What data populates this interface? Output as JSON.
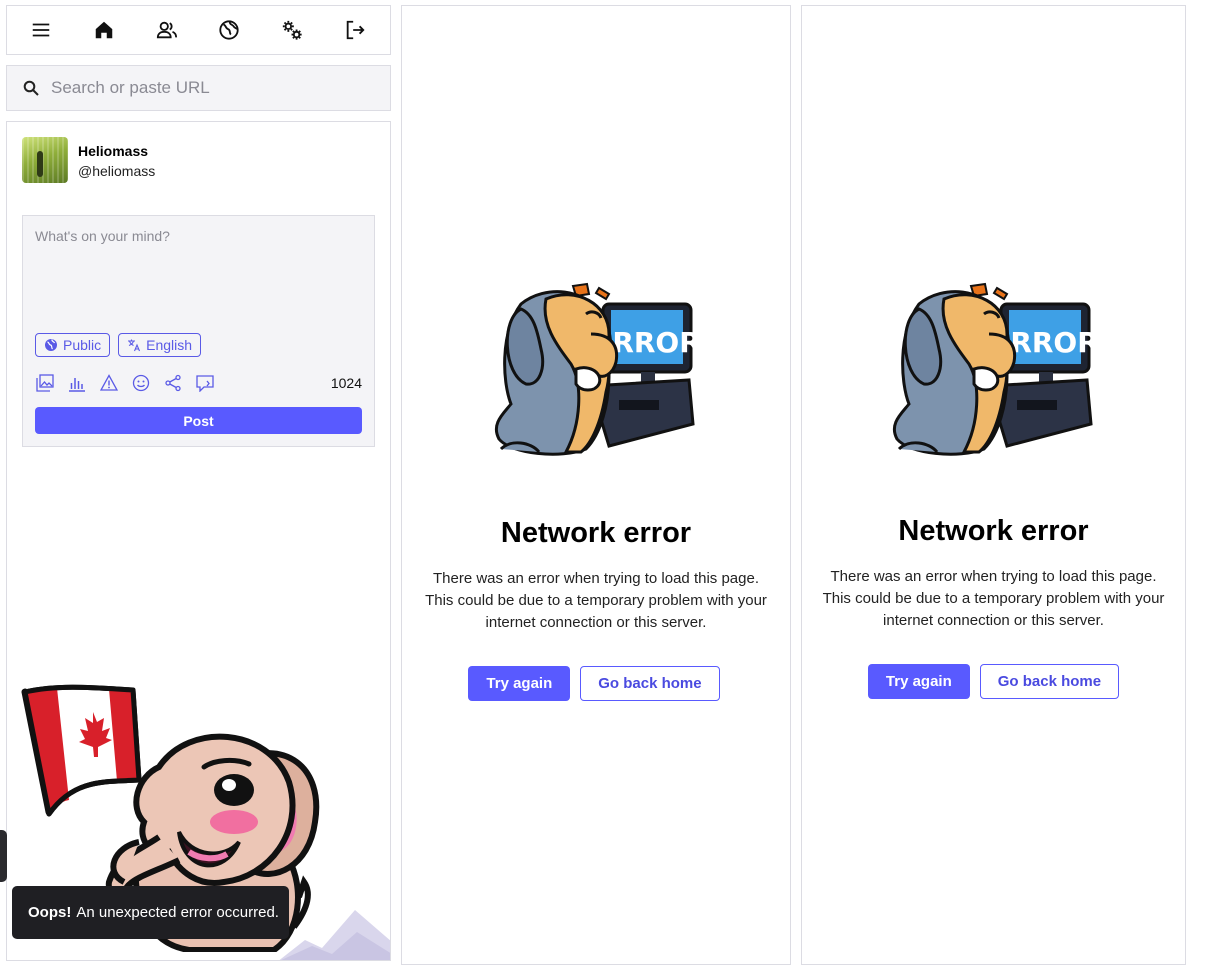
{
  "nav": {
    "items": [
      {
        "icon": "menu-icon",
        "label": "Menu"
      },
      {
        "icon": "home-icon",
        "label": "Home"
      },
      {
        "icon": "people-icon",
        "label": "People"
      },
      {
        "icon": "globe-icon",
        "label": "Federated"
      },
      {
        "icon": "gears-icon",
        "label": "Preferences"
      },
      {
        "icon": "logout-icon",
        "label": "Logout"
      }
    ]
  },
  "search": {
    "placeholder": "Search or paste URL"
  },
  "account": {
    "display_name": "Heliomass",
    "handle": "@heliomass"
  },
  "compose": {
    "placeholder": "What's on your mind?",
    "visibility_label": "Public",
    "language_label": "English",
    "tools": [
      "image-icon",
      "poll-icon",
      "content-warning-icon",
      "emoji-icon",
      "share-icon",
      "quote-icon"
    ],
    "char_count": "1024",
    "post_label": "Post"
  },
  "toast": {
    "strong": "Oops!",
    "message": "An unexpected error occurred."
  },
  "columns": [
    {
      "art_text": "ERROR",
      "title": "Network error",
      "body_lines": [
        "There was an error when trying to load this page.",
        "This could be due to a temporary problem with your",
        "internet connection or this server."
      ],
      "retry_label": "Try again",
      "home_label": "Go back home"
    },
    {
      "art_text": "ERROR",
      "title": "Network error",
      "body_lines": [
        "There was an error when trying to load this page.",
        "This could be due to a temporary problem with your",
        "internet connection or this server."
      ],
      "retry_label": "Try again",
      "home_label": "Go back home"
    }
  ],
  "colors": {
    "accent": "#595aff",
    "toast_bg": "#1f1f23",
    "border": "#dcdce3"
  }
}
